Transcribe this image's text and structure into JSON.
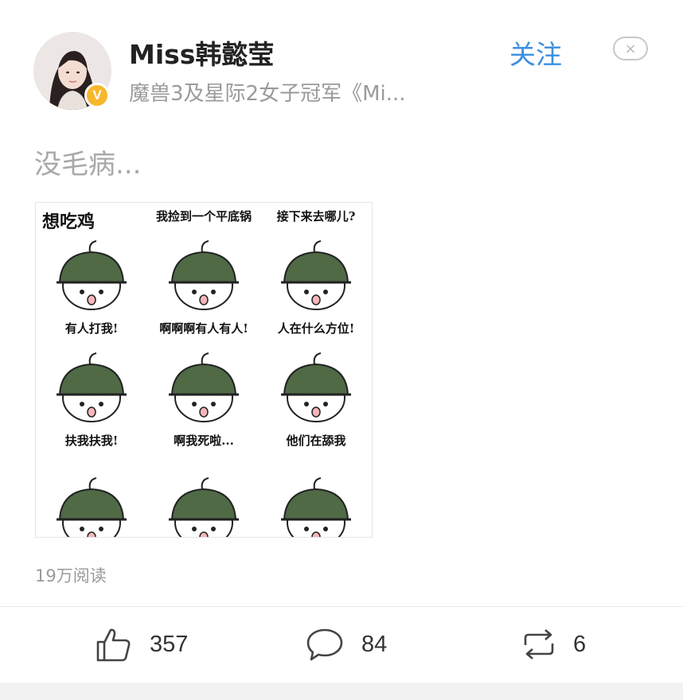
{
  "author": {
    "name": "Miss韩懿莹",
    "description": "魔兽3及星际2女子冠军《Mi...",
    "verified_badge": "V",
    "avatar_icon": "avatar-photo"
  },
  "header": {
    "follow_label": "关注",
    "close_symbol": "×"
  },
  "post": {
    "text": "没毛病...",
    "reads": "19万阅读"
  },
  "comic": {
    "panels": [
      {
        "caption": "想吃鸡"
      },
      {
        "caption": "我捡到一个平底锅"
      },
      {
        "caption": "接下来去哪儿?"
      },
      {
        "caption": "有人打我!"
      },
      {
        "caption": "啊啊啊有人有人!"
      },
      {
        "caption": "人在什么方位!"
      },
      {
        "caption": "扶我扶我!"
      },
      {
        "caption": "啊我死啦..."
      },
      {
        "caption": "他们在舔我"
      }
    ]
  },
  "actions": {
    "like_count": "357",
    "comment_count": "84",
    "repost_count": "6",
    "like_icon": "thumbs-up-icon",
    "comment_icon": "comment-bubble-icon",
    "repost_icon": "repost-icon"
  },
  "colors": {
    "accent": "#3d8fe0",
    "badge": "#f6b72b",
    "helmet": "#4f6a45"
  }
}
